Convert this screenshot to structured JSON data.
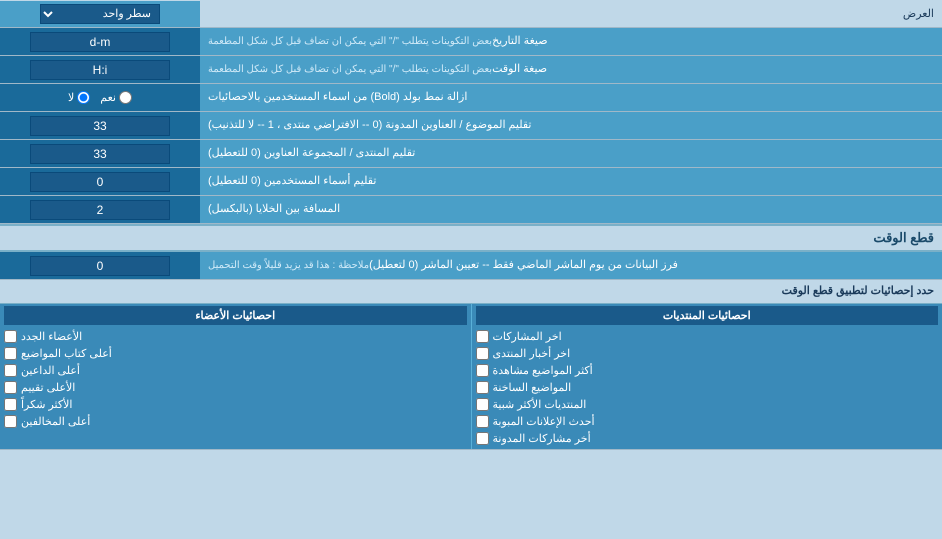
{
  "header": {
    "label": "العرض",
    "dropdown_label": "سطر واحد"
  },
  "rows": [
    {
      "id": "date_format",
      "label": "صيغة التاريخ",
      "sublabel": "بعض التكوينات يتطلب \"/\" التي يمكن ان تضاف قبل كل شكل المطعمة",
      "value": "d-m",
      "type": "text"
    },
    {
      "id": "time_format",
      "label": "صيغة الوقت",
      "sublabel": "بعض التكوينات يتطلب \"/\" التي يمكن ان تضاف قبل كل شكل المطعمة",
      "value": "H:i",
      "type": "text"
    },
    {
      "id": "bold_remove",
      "label": "ازالة نمط بولد (Bold) من اسماء المستخدمين بالاحصائيات",
      "type": "radio",
      "options": [
        "نعم",
        "لا"
      ],
      "selected": "لا"
    },
    {
      "id": "forum_topic_trim",
      "label": "تقليم الموضوع / العناوين المدونة (0 -- الافتراضي منتدى ، 1 -- لا للتذنيب)",
      "value": "33",
      "type": "text"
    },
    {
      "id": "forum_group_trim",
      "label": "تقليم المنتدى / المجموعة العناوين (0 للتعطيل)",
      "value": "33",
      "type": "text"
    },
    {
      "id": "user_names_trim",
      "label": "تقليم أسماء المستخدمين (0 للتعطيل)",
      "value": "0",
      "type": "text"
    },
    {
      "id": "cell_spacing",
      "label": "المسافة بين الخلايا (بالبكسل)",
      "value": "2",
      "type": "text"
    }
  ],
  "section_cutoff": {
    "title": "قطع الوقت",
    "row": {
      "id": "cutoff_days",
      "label": "فرز البيانات من يوم الماشر الماضي فقط -- تعيين الماشر (0 لتعطيل)",
      "sublabel": "ملاحظة : هذا قد يزيد قليلاً وقت التحميل",
      "value": "0",
      "type": "text"
    }
  },
  "checkboxes_section": {
    "header_label": "حدد إحصائيات لتطبيق قطع الوقت",
    "col1": {
      "title": "احصائيات المنتديات",
      "items": [
        "اخر المشاركات",
        "اخر أخبار المنتدى",
        "أكثر المواضيع مشاهدة",
        "المواضيع الساخنة",
        "المنتديات الأكثر شبية",
        "أحدث الإعلانات المبوبة",
        "أخر مشاركات المدونة"
      ]
    },
    "col2": {
      "title": "احصائيات الأعضاء",
      "items": [
        "الأعضاء الجدد",
        "أعلى كتاب المواضيع",
        "أعلى الداعين",
        "الأعلى تقييم",
        "الأكثر شكراً",
        "أعلى المخالفين"
      ]
    }
  }
}
